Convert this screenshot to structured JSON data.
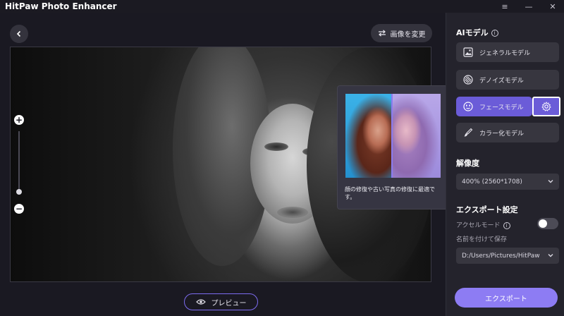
{
  "app": {
    "title": "HitPaw Photo Enhancer"
  },
  "window_controls": [
    {
      "name": "menu-icon",
      "glyph": "≡"
    },
    {
      "name": "minimize-icon",
      "glyph": "—"
    },
    {
      "name": "close-icon",
      "glyph": "✕"
    }
  ],
  "toolbar": {
    "change_image_label": "画像を変更"
  },
  "preview": {
    "label": "プレビュー"
  },
  "popup": {
    "caption": "顔の修復や古い写真の修復に最適です。"
  },
  "panel": {
    "ai_model_title": "AIモデル",
    "models": [
      {
        "label": "ジェネラルモデル",
        "icon": "image-icon",
        "active": false
      },
      {
        "label": "デノイズモデル",
        "icon": "denoise-icon",
        "active": false
      },
      {
        "label": "フェースモデル",
        "icon": "face-icon",
        "active": true
      },
      {
        "label": "カラー化モデル",
        "icon": "brush-icon",
        "active": false
      }
    ],
    "resolution_title": "解像度",
    "resolution_value": "400% (2560*1708)",
    "export_settings_title": "エクスポート設定",
    "accel_mode_label": "アクセルモード",
    "accel_mode_on": false,
    "save_as_label": "名前を付けて保存",
    "save_path": "D:/Users/Pictures/HitPaw",
    "export_label": "エクスポート"
  },
  "colors": {
    "accent": "#8d7cf3",
    "active_model": "#6b5cd8"
  }
}
